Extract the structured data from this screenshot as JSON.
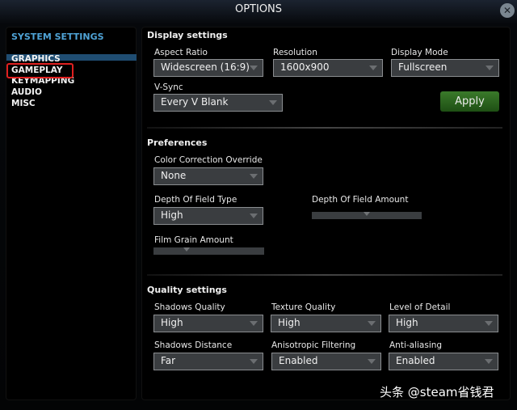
{
  "window": {
    "title": "OPTIONS"
  },
  "sidebar": {
    "heading": "SYSTEM SETTINGS",
    "items": [
      {
        "label": "GRAPHICS",
        "selected": true
      },
      {
        "label": "GAMEPLAY",
        "highlighted": true
      },
      {
        "label": "KEYMAPPING"
      },
      {
        "label": "AUDIO"
      },
      {
        "label": "MISC"
      }
    ]
  },
  "display": {
    "heading": "Display settings",
    "aspect_label": "Aspect Ratio",
    "aspect_value": "Widescreen (16:9)",
    "resolution_label": "Resolution",
    "resolution_value": "1600x900",
    "mode_label": "Display Mode",
    "mode_value": "Fullscreen",
    "vsync_label": "V-Sync",
    "vsync_value": "Every V Blank",
    "apply_label": "Apply"
  },
  "preferences": {
    "heading": "Preferences",
    "color_label": "Color Correction Override",
    "color_value": "None",
    "dof_type_label": "Depth Of Field Type",
    "dof_type_value": "High",
    "dof_amount_label": "Depth Of Field Amount",
    "dof_amount_fraction": 0.5,
    "film_grain_label": "Film Grain Amount",
    "film_grain_fraction": 0.3
  },
  "quality": {
    "heading": "Quality settings",
    "shadows_quality_label": "Shadows Quality",
    "shadows_quality_value": "High",
    "texture_label": "Texture Quality",
    "texture_value": "High",
    "lod_label": "Level of Detail",
    "lod_value": "High",
    "shadow_dist_label": "Shadows Distance",
    "shadow_dist_value": "Far",
    "aniso_label": "Anisotropic Filtering",
    "aniso_value": "Enabled",
    "aa_label": "Anti-aliasing",
    "aa_value": "Enabled"
  },
  "watermark": "头条 @steam省钱君",
  "colors": {
    "accent": "#4fa3d6",
    "apply": "#2e6a20",
    "highlight_box": "#e02020"
  }
}
